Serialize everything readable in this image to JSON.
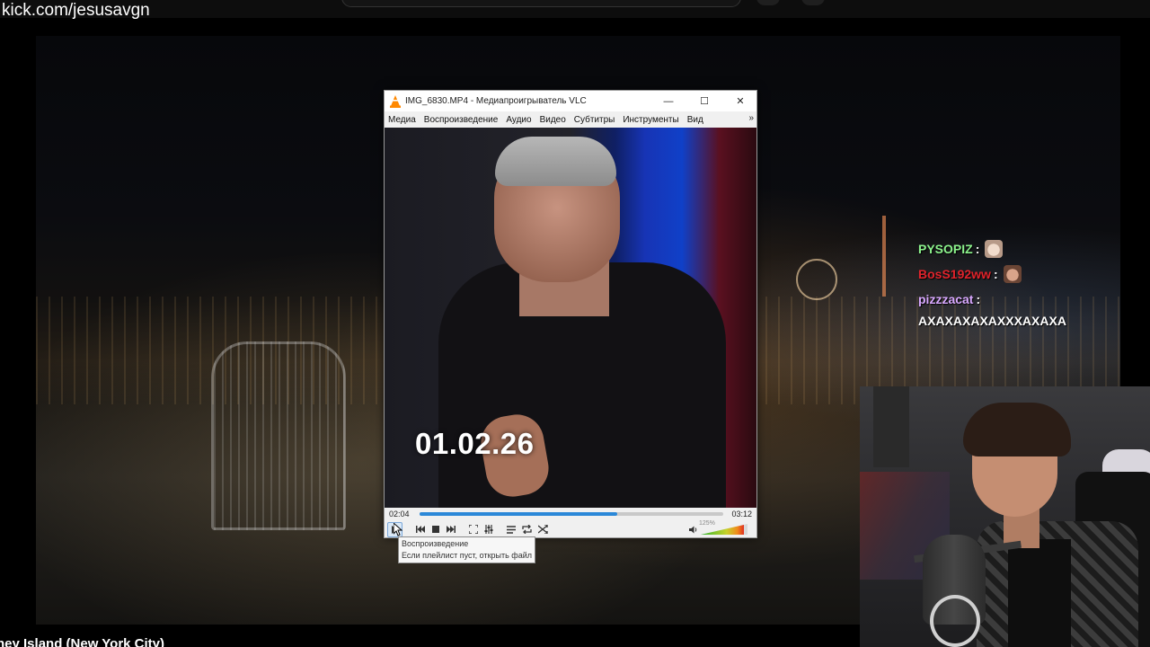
{
  "stream": {
    "url": "kick.com/jesusavgn",
    "location_caption": "ney Island (New York City)"
  },
  "chat": [
    {
      "user": "PYSOPIZ",
      "color": "#8cf28c",
      "colon": ":",
      "emote": "cat-emote"
    },
    {
      "user": "BosS192ww",
      "color": "#e0232b",
      "colon": ":",
      "emote": "face-emote"
    },
    {
      "user": "pizzzacat",
      "color": "#d8a8ff",
      "colon": ":",
      "message": "AXAXAXAXAXXXAXAXA"
    }
  ],
  "vlc": {
    "title": "IMG_6830.MP4 - Медиапроигрыватель VLC",
    "window_buttons": {
      "minimize": "—",
      "maximize": "☐",
      "close": "✕"
    },
    "menu": [
      "Медиа",
      "Воспроизведение",
      "Аудио",
      "Видео",
      "Субтитры",
      "Инструменты",
      "Вид"
    ],
    "menu_more": "»",
    "video_overlay_text": "01.02.26",
    "time_current": "02:04",
    "time_total": "03:12",
    "progress_fraction": 0.65,
    "volume_label": "125%",
    "tooltip": {
      "title": "Воспроизведение",
      "hint": "Если плейлист пуст, открыть файл"
    },
    "icons": {
      "play": "play-icon",
      "prev": "previous-icon",
      "stop": "stop-icon",
      "next": "next-icon",
      "fullscreen": "fullscreen-icon",
      "extended": "extended-settings-icon",
      "playlist": "playlist-icon",
      "loop": "loop-icon",
      "shuffle": "shuffle-icon",
      "volume": "volume-icon"
    },
    "accent": "#2b88d8"
  }
}
